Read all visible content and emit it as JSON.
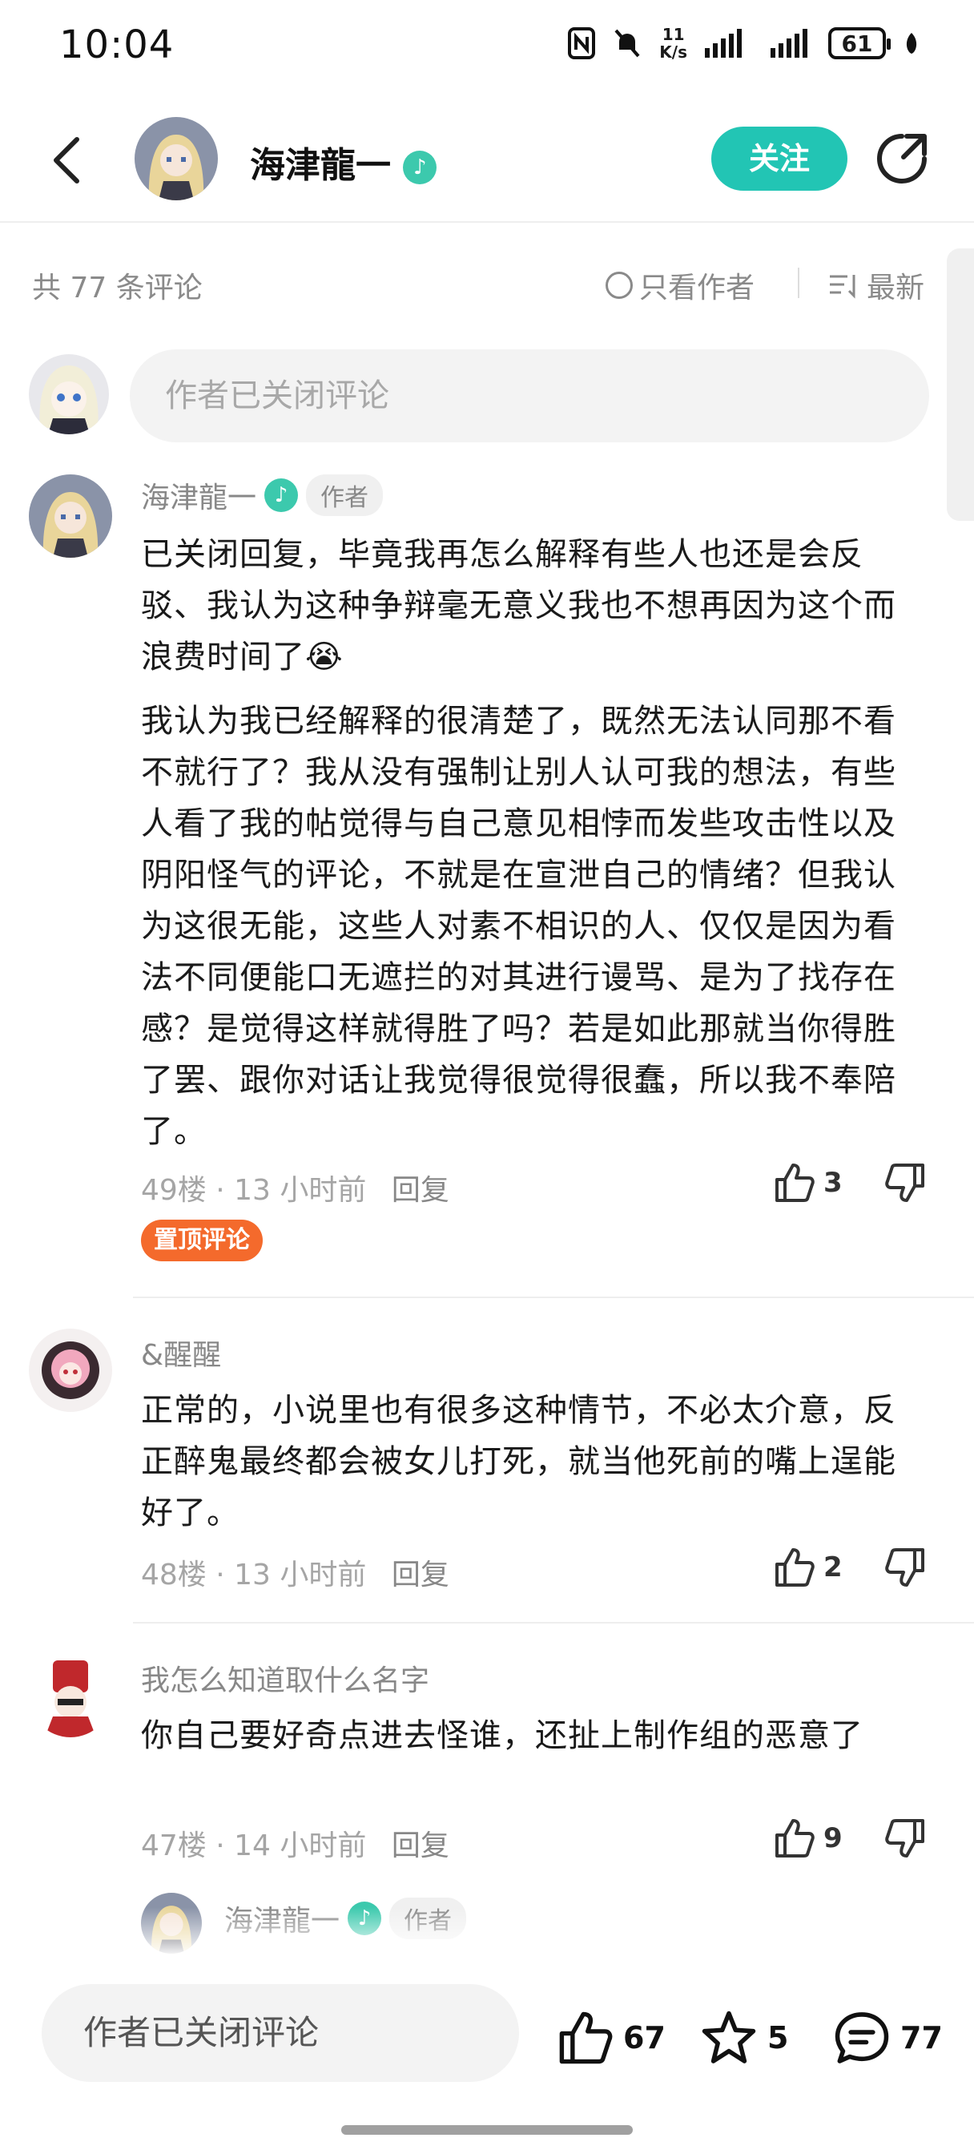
{
  "status_bar": {
    "time": "10:04",
    "net_speed_value": "11",
    "net_speed_unit": "K/s",
    "battery": "61"
  },
  "header": {
    "author_name": "海津龍一",
    "follow_label": "关注"
  },
  "filter": {
    "count_label": "共 77 条评论",
    "only_author_label": "只看作者",
    "sort_label": "最新"
  },
  "input": {
    "placeholder": "作者已关闭评论"
  },
  "comments": [
    {
      "name": "海津龍一",
      "verified": true,
      "author_tag": "作者",
      "paragraphs": [
        "已关闭回复，毕竟我再怎么解释有些人也还是会反驳、我认为这种争辩毫无意义我也不想再因为这个而浪费时间了😭",
        "我认为我已经解释的很清楚了，既然无法认同那不看不就行了？我从没有强制让别人认可我的想法，有些人看了我的帖觉得与自己意见相悖而发些攻击性以及阴阳怪气的评论，不就是在宣泄自己的情绪？但我认为这很无能，这些人对素不相识的人、仅仅是因为看法不同便能口无遮拦的对其进行谩骂、是为了找存在感？是觉得这样就得胜了吗？若是如此那就当你得胜了罢、跟你对话让我觉得很觉得很蠢，所以我不奉陪了。"
      ],
      "floor": "49楼",
      "time": "13 小时前",
      "reply": "回复",
      "likes": "3",
      "pinned_label": "置顶评论"
    },
    {
      "name": "&醒醒",
      "paragraphs": [
        "正常的，小说里也有很多这种情节，不必太介意，反正醉鬼最终都会被女儿打死，就当他死前的嘴上逞能好了。"
      ],
      "floor": "48楼",
      "time": "13 小时前",
      "reply": "回复",
      "likes": "2"
    },
    {
      "name": "我怎么知道取什么名字",
      "paragraphs": [
        "你自己要好奇点进去怪谁，还扯上制作组的恶意了"
      ],
      "floor": "47楼",
      "time": "14 小时前",
      "reply": "回复",
      "likes": "9"
    },
    {
      "name": "海津龍一",
      "verified": true,
      "author_tag": "作者"
    }
  ],
  "bottom_bar": {
    "placeholder": "作者已关闭评论",
    "likes": "67",
    "favorites": "5",
    "comments": "77"
  },
  "colors": {
    "accent": "#22c5b4",
    "pinned": "#f46a2c",
    "verified": "#3cc9ad"
  }
}
